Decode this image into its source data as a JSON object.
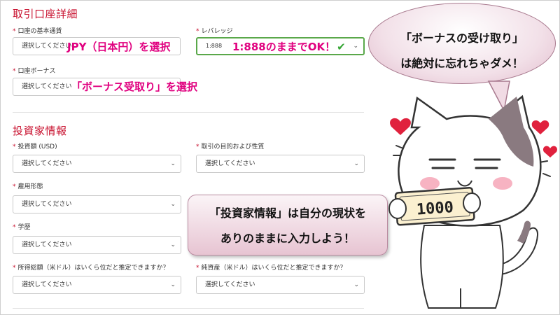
{
  "account": {
    "title": "取引口座詳細",
    "base_currency": {
      "label": "口座の基本通貨",
      "value": "選択してください"
    },
    "leverage": {
      "label": "レバレッジ",
      "value": "1:888"
    },
    "bonus": {
      "label": "口座ボーナス",
      "value": "選択してください"
    }
  },
  "investor": {
    "title": "投資家情報",
    "investment_amount": {
      "label": "投資額 (USD)",
      "value": "選択してください"
    },
    "purpose": {
      "label": "取引の目的および性質",
      "value": "選択してください"
    },
    "employment": {
      "label": "雇用形態",
      "value": "選択してください"
    },
    "education": {
      "label": "学歴",
      "value": "選択してください"
    },
    "annual_income": {
      "label": "所得総額（米ドル）はいくら位だと推定できますか？",
      "value": "選択してください"
    },
    "net_assets": {
      "label": "純資産（米ドル）はいくら位だと推定できますか？",
      "value": "選択してください"
    }
  },
  "annotations": {
    "currency_note": "JPY（日本円）を選択",
    "leverage_note": "1:888のままでOK！",
    "bonus_note": "「ボーナス受取り」を選択",
    "investor_note_line1": "「投資家情報」は自分の現状を",
    "investor_note_line2": "ありのままに入力しよう！",
    "speech_line1": "「ボーナスの受け取り」",
    "speech_line2": "は絶対に忘れちゃダメ！",
    "money_card": "1000"
  },
  "colors": {
    "accent_red": "#c8102e",
    "highlight_pink": "#e0007f",
    "ok_green": "#33a532",
    "callout_pink": "#e7c4d2"
  }
}
